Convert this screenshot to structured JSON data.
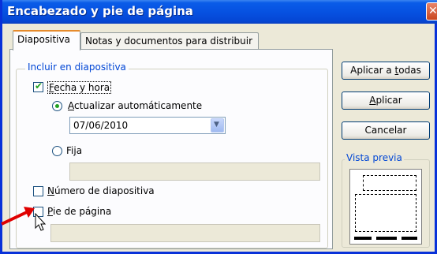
{
  "window": {
    "title": "Encabezado y pie de página",
    "close_label": "✕"
  },
  "tabs": [
    {
      "label": "Diapositiva",
      "active": true
    },
    {
      "label": "Notas y documentos para distribuir",
      "active": false
    }
  ],
  "group": {
    "label": "Incluir en diapositiva",
    "fecha_hora": {
      "before": "",
      "mnemonic": "F",
      "after": "echa y hora",
      "checked": true
    },
    "actualizar": {
      "before": "",
      "mnemonic": "A",
      "after": "ctualizar automáticamente",
      "selected": true
    },
    "date_value": "07/06/2010",
    "fija": {
      "before": "Fi",
      "mnemonic": "j",
      "after": "a",
      "selected": false
    },
    "numero": {
      "before": "",
      "mnemonic": "N",
      "after": "úmero de diapositiva",
      "checked": false
    },
    "pie": {
      "before": "",
      "mnemonic": "P",
      "after": "ie de página",
      "checked": false
    }
  },
  "buttons": {
    "aplicar_todas": {
      "before": "Aplicar a ",
      "mnemonic": "t",
      "after": "odas"
    },
    "aplicar": {
      "before": "",
      "mnemonic": "A",
      "after": "plicar"
    },
    "cancelar": {
      "before": "",
      "mnemonic": "",
      "after": "Cancelar"
    }
  },
  "preview": {
    "label": "Vista previa"
  },
  "colors": {
    "titlebar": "#0650e0",
    "group_label": "#0046d5",
    "annotation_arrow": "#e00000",
    "check": "#21a121"
  }
}
